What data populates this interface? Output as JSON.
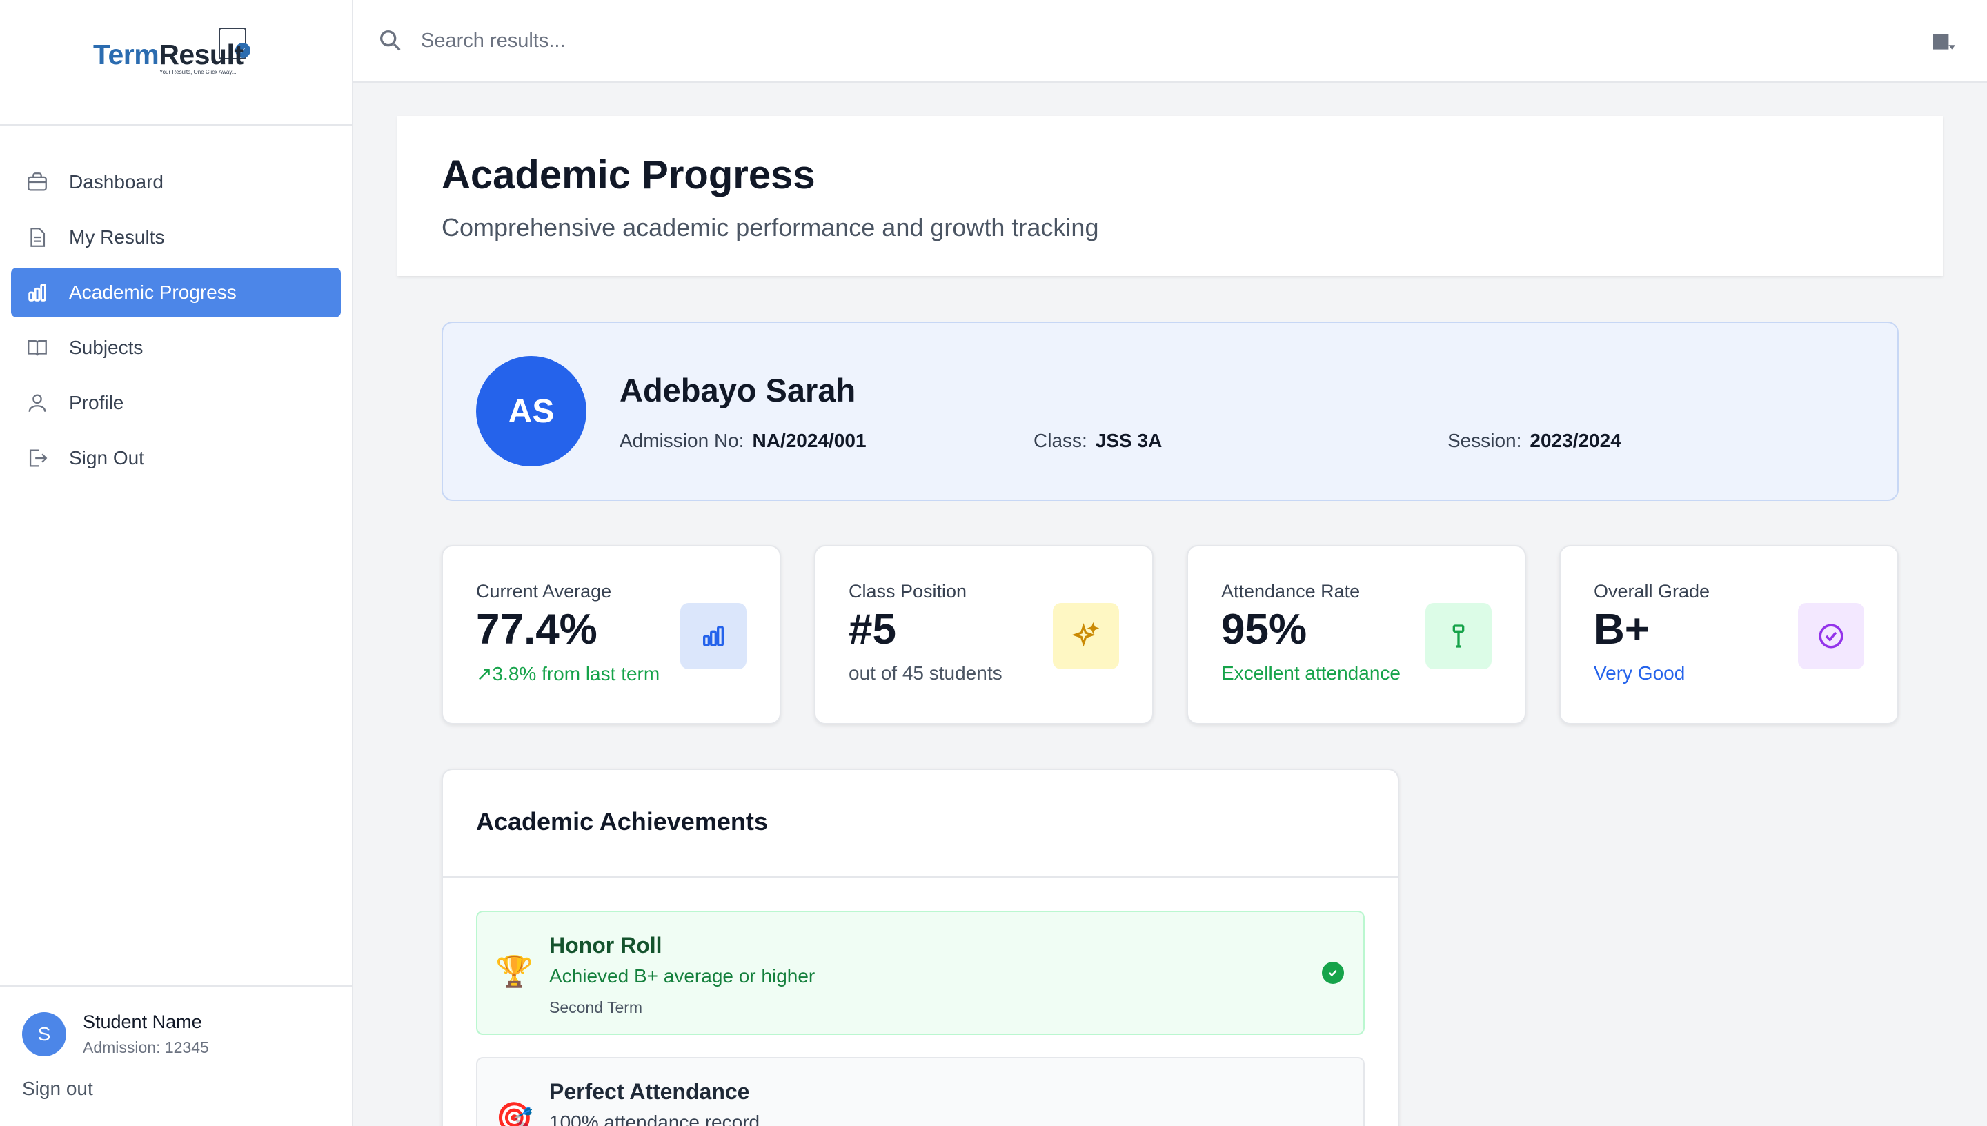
{
  "brand": {
    "term": "Term",
    "result": "Result",
    "tagline": "Your Results, One Click Away..."
  },
  "sidebar": {
    "items": [
      {
        "label": "Dashboard",
        "icon": "briefcase-icon"
      },
      {
        "label": "My Results",
        "icon": "document-icon"
      },
      {
        "label": "Academic Progress",
        "icon": "bar-chart-icon",
        "active": true
      },
      {
        "label": "Subjects",
        "icon": "book-icon"
      },
      {
        "label": "Profile",
        "icon": "user-icon"
      },
      {
        "label": "Sign Out",
        "icon": "logout-icon"
      }
    ],
    "user": {
      "initial": "S",
      "name": "Student Name",
      "admission": "Admission: 12345",
      "signout": "Sign out"
    }
  },
  "search": {
    "placeholder": "Search results..."
  },
  "header": {
    "title": "Academic Progress",
    "subtitle": "Comprehensive academic performance and growth tracking"
  },
  "student": {
    "initials": "AS",
    "name": "Adebayo Sarah",
    "admission_label": "Admission No:",
    "admission_value": "NA/2024/001",
    "class_label": "Class:",
    "class_value": "JSS 3A",
    "session_label": "Session:",
    "session_value": "2023/2024"
  },
  "stats": [
    {
      "label": "Current Average",
      "value": "77.4%",
      "sub": "↗3.8% from last term",
      "sub_color": "#16a34a",
      "icon": "bar-chart-icon",
      "icon_bg": "#dbe6fb",
      "icon_color": "#2563eb"
    },
    {
      "label": "Class Position",
      "value": "#5",
      "sub": "out of 45 students",
      "sub_color": "#4b5563",
      "icon": "sparkles-icon",
      "icon_bg": "#fef7c3",
      "icon_color": "#ca8a04"
    },
    {
      "label": "Attendance Rate",
      "value": "95%",
      "sub": "Excellent attendance",
      "sub_color": "#16a34a",
      "icon": "gavel-icon",
      "icon_bg": "#dcfce7",
      "icon_color": "#16a34a"
    },
    {
      "label": "Overall Grade",
      "value": "B+",
      "sub": "Very Good",
      "sub_color": "#2563eb",
      "icon": "check-circle-icon",
      "icon_bg": "#f3e8ff",
      "icon_color": "#9333ea"
    }
  ],
  "achievements": {
    "title": "Academic Achievements",
    "items": [
      {
        "emoji": "🏆",
        "name": "Honor Roll",
        "desc": "Achieved B+ average or higher",
        "term": "Second Term"
      },
      {
        "emoji": "🎯",
        "name": "Perfect Attendance",
        "desc": "100% attendance record",
        "term": ""
      }
    ]
  }
}
